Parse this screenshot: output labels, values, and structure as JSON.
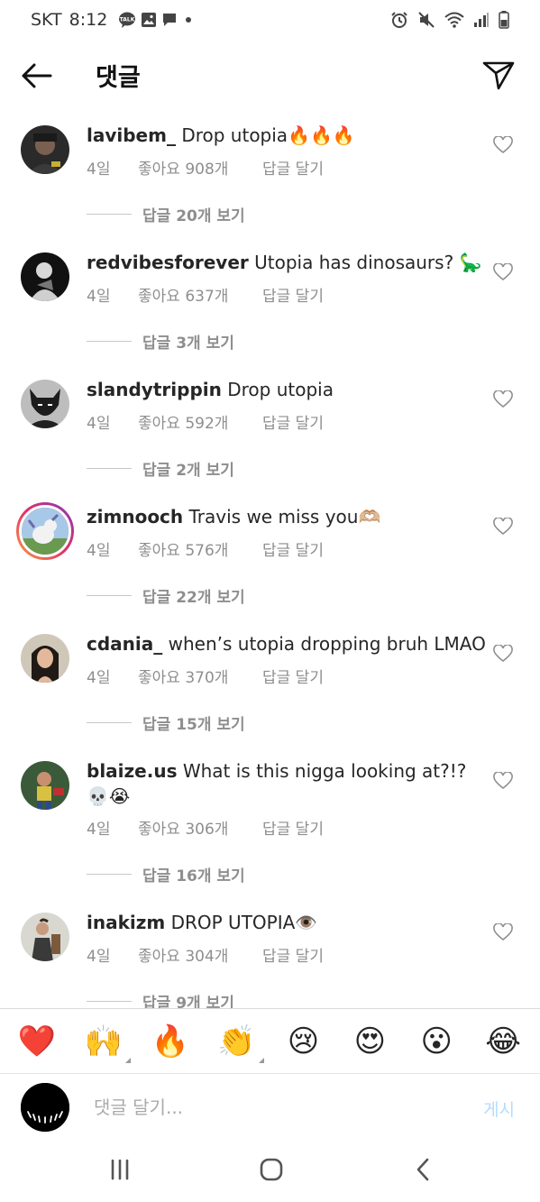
{
  "status_bar": {
    "carrier": "SKT",
    "time": "8:12",
    "talk_badge": "TALK"
  },
  "header": {
    "title": "댓글"
  },
  "comments": [
    {
      "username": "lavibem_",
      "text": "Drop utopia🔥🔥🔥",
      "time": "4일",
      "likes": "좋아요 908개",
      "reply_label": "답글 달기",
      "view_replies": "답글 20개 보기"
    },
    {
      "username": "redvibesforever",
      "text": "Utopia has dinosaurs? 🦕",
      "time": "4일",
      "likes": "좋아요 637개",
      "reply_label": "답글 달기",
      "view_replies": "답글 3개 보기"
    },
    {
      "username": "slandytrippin",
      "text": "Drop utopia",
      "time": "4일",
      "likes": "좋아요 592개",
      "reply_label": "답글 달기",
      "view_replies": "답글 2개 보기"
    },
    {
      "username": "zimnooch",
      "text": "Travis we miss you🫶🏼",
      "time": "4일",
      "likes": "좋아요 576개",
      "reply_label": "답글 달기",
      "view_replies": "답글 22개 보기"
    },
    {
      "username": "cdania_",
      "text": "when’s utopia dropping bruh LMAO",
      "time": "4일",
      "likes": "좋아요 370개",
      "reply_label": "답글 달기",
      "view_replies": "답글 15개 보기"
    },
    {
      "username": "blaize.us",
      "text": "What is this nigga looking at?!? 💀😭",
      "time": "4일",
      "likes": "좋아요 306개",
      "reply_label": "답글 달기",
      "view_replies": "답글 16개 보기"
    },
    {
      "username": "inakizm",
      "text": "DROP UTOPIA👁️",
      "time": "4일",
      "likes": "좋아요 304개",
      "reply_label": "답글 달기",
      "view_replies": "답글 9개 보기"
    }
  ],
  "emoji_bar": [
    "❤️",
    "🙌",
    "🔥",
    "👏",
    "😢",
    "😍",
    "😮",
    "😂"
  ],
  "input": {
    "placeholder": "댓글 달기...",
    "post_label": "게시"
  },
  "colors": {
    "secondary_text": "#8e8e8e",
    "post_disabled": "#b3dbff"
  }
}
